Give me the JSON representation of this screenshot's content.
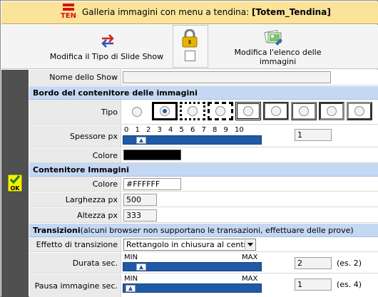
{
  "header": {
    "icon_text": "TEN",
    "title_prefix": "Galleria immagini con menu a tendina: ",
    "title_name": "[Totem_Tendina]"
  },
  "toolbar": {
    "slideshow_label": "Modifica il Tipo di Slide Show",
    "lock_checked": false,
    "images_label": "Modifica l'elenco delle immagini"
  },
  "form": {
    "show_name": {
      "label": "Nome dello Show",
      "value": ""
    },
    "border_section": "Bordo del contenitore delle immagini",
    "tipo": {
      "label": "Tipo",
      "selected_index": 1,
      "option_count": 9
    },
    "spessore": {
      "label": "Spessore px",
      "ticks": [
        "0",
        "1",
        "2",
        "3",
        "4",
        "5",
        "6",
        "7",
        "8",
        "9",
        "10"
      ],
      "value": "1"
    },
    "colore_bordo": {
      "label": "Colore",
      "value_color": "#000000"
    },
    "container_section": "Contenitore Immagini",
    "colore": {
      "label": "Colore",
      "value": "#FFFFFF"
    },
    "larghezza": {
      "label": "Larghezza px",
      "value": "500"
    },
    "altezza": {
      "label": "Altezza px",
      "value": "333"
    },
    "transitions_section_bold": "Transizioni",
    "transitions_section_note": " (alcuni browser non supportano le transazioni, effettuare delle prove)",
    "effetto": {
      "label": "Effetto di transizione",
      "value": "Rettangolo in chiusura al centro"
    },
    "durata": {
      "label": "Durata sec.",
      "min": "MIN",
      "max": "MAX",
      "value": "2",
      "example": "(es. 2)"
    },
    "pausa": {
      "label": "Pausa immagine sec.",
      "min": "MIN",
      "max": "MAX",
      "value": "1",
      "example": "(es. 4)"
    }
  },
  "ok_label": "OK",
  "colors": {
    "title_bg": "#fce39a",
    "section_bg": "#c5d8f3",
    "slider": "#1f5aa8",
    "left_strip": "#505050"
  }
}
